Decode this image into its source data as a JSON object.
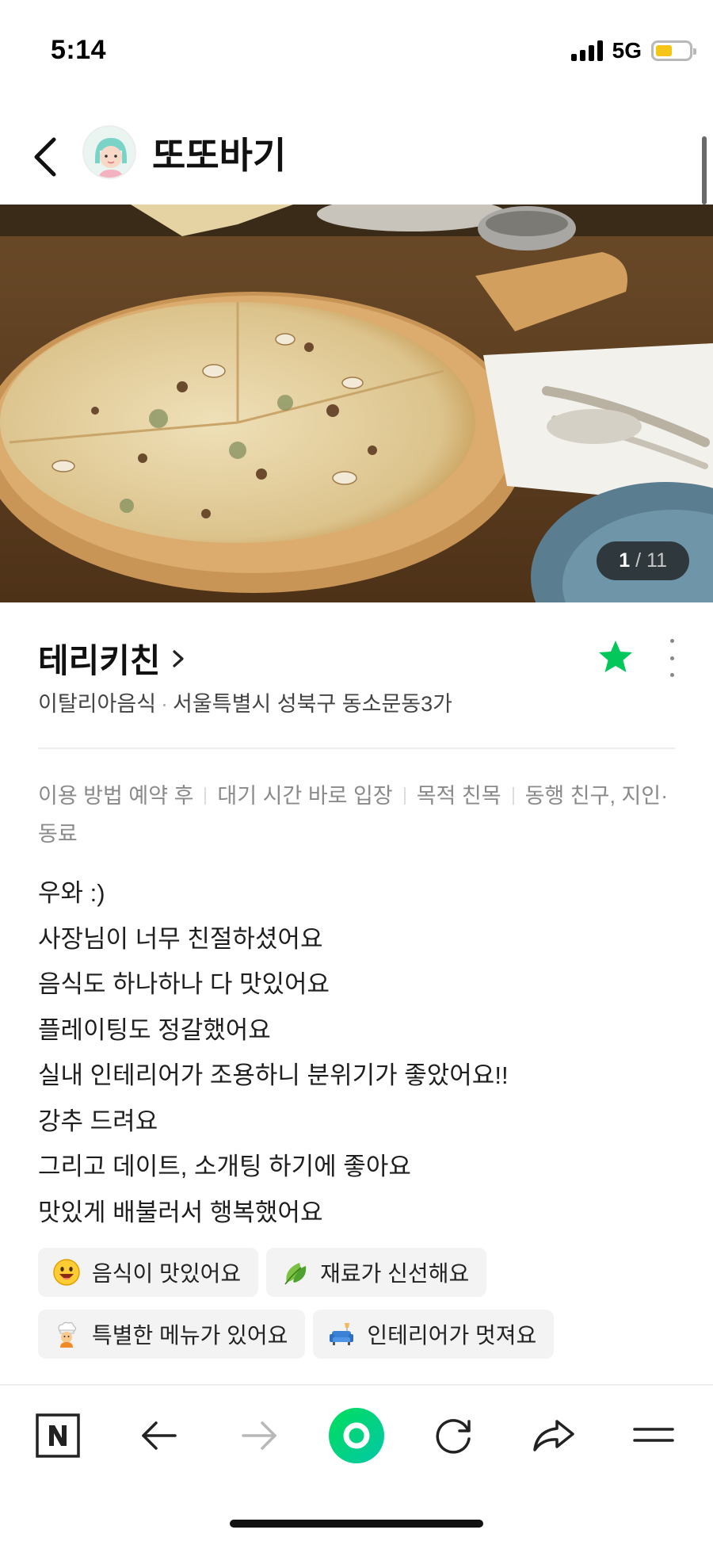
{
  "status_bar": {
    "time": "5:14",
    "network": "5G",
    "battery_level": 0.5,
    "battery_color": "#f5c518"
  },
  "header": {
    "back_icon": "chevron-left-icon",
    "profile_name": "또또바기"
  },
  "photo": {
    "current": "1",
    "total": "11",
    "separator": "/"
  },
  "place": {
    "name": "테리키친",
    "category": "이탈리아음식",
    "meta_separator": "·",
    "address": "서울특별시 성북구 동소문동3가",
    "favorite_color": "#03c75a"
  },
  "visit_info": [
    {
      "label": "이용 방법",
      "value": "예약 후"
    },
    {
      "label": "대기 시간",
      "value": "바로 입장"
    },
    {
      "label": "목적",
      "value": "친목"
    },
    {
      "label": "동행",
      "value": "친구, 지인·동료"
    }
  ],
  "review": {
    "lines": [
      "우와 :)",
      "사장님이 너무 친절하셨어요",
      "음식도 하나하나 다 맛있어요",
      "플레이팅도 정갈했어요",
      "실내 인테리어가 조용하니 분위기가 좋았어요!!",
      "강추 드려요",
      "그리고 데이트, 소개팅 하기에 좋아요",
      "맛있게 배불러서 행복했어요"
    ]
  },
  "tags": [
    {
      "icon": "smiley-face-icon",
      "label": "음식이 맛있어요"
    },
    {
      "icon": "leaf-icon",
      "label": "재료가 신선해요"
    },
    {
      "icon": "chef-icon",
      "label": "특별한 메뉴가 있어요"
    },
    {
      "icon": "sofa-icon",
      "label": "인테리어가 멋져요"
    }
  ],
  "toolbar": {
    "items": [
      "naver-n-icon",
      "back-arrow-icon",
      "forward-arrow-icon",
      "green-dot-icon",
      "refresh-icon",
      "share-icon",
      "menu-icon"
    ],
    "accent": "#03c75a"
  }
}
